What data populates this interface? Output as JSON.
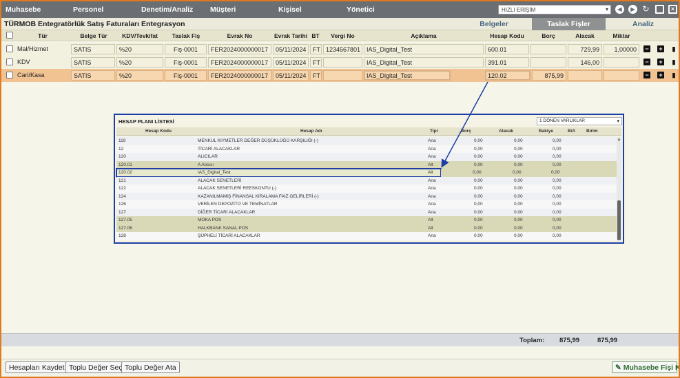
{
  "nav": {
    "items": [
      "Muhasebe",
      "Personel",
      "Denetim/Analiz",
      "Müşteri",
      "Kişisel",
      "Yönetici"
    ],
    "quick_access": "HIZLI ERİŞİM"
  },
  "title_bar": {
    "title": "TÜRMOB Entegratörlük Satış Faturaları Entegrasyon",
    "tabs": [
      "Belgeler",
      "Taslak Fişler",
      "Analiz"
    ],
    "active_tab": "Taslak Fişler"
  },
  "grid": {
    "headers": [
      "Tür",
      "Belge Tür",
      "KDV/Tevkifat",
      "Taslak Fiş",
      "Evrak No",
      "Evrak Tarihi",
      "BT",
      "Vergi No",
      "Açıklama",
      "Hesap Kodu",
      "Borç",
      "Alacak",
      "Miktar"
    ],
    "rows": [
      {
        "tur": "Mal/Hizmet",
        "belge_tur": "SATIS",
        "kdv": "%20",
        "taslak_fis": "Fiş-0001",
        "evrak_no": "FER2024000000017",
        "evrak_tarihi": "05/11/2024",
        "bt": "FT",
        "vergi_no": "1234567801",
        "aciklama": "IAS_Digital_Test",
        "hesap_kodu": "600.01",
        "borc": "",
        "alacak": "729,99",
        "miktar": "1,00000"
      },
      {
        "tur": "KDV",
        "belge_tur": "SATIS",
        "kdv": "%20",
        "taslak_fis": "Fiş-0001",
        "evrak_no": "FER2024000000017",
        "evrak_tarihi": "05/11/2024",
        "bt": "FT",
        "vergi_no": "",
        "aciklama": "IAS_Digital_Test",
        "hesap_kodu": "391.01",
        "borc": "",
        "alacak": "146,00",
        "miktar": ""
      },
      {
        "tur": "Cari/Kasa",
        "belge_tur": "SATIS",
        "kdv": "%20",
        "taslak_fis": "Fiş-0001",
        "evrak_no": "FER2024000000017",
        "evrak_tarihi": "05/11/2024",
        "bt": "FT",
        "vergi_no": "",
        "aciklama": "IAS_Digital_Test",
        "hesap_kodu": "120.02",
        "borc": "875,99",
        "alacak": "",
        "miktar": ""
      }
    ]
  },
  "popup": {
    "title": "HESAP PLANI LİSTESİ",
    "select_value": "1 DÖNEN VARLIKLAR",
    "headers": [
      "Hesap Kodu",
      "Hesap Adı",
      "Tipi",
      "Borç",
      "Alacak",
      "Bakiye",
      "B/A",
      "Birim"
    ],
    "rows": [
      {
        "kod": "119",
        "ad": "MENKUL KIYMETLER DEĞER DÜŞÜKLÜĞÜ KARŞILIĞI (-)",
        "tip": "Ana",
        "borc": "0,00",
        "alacak": "0,00",
        "bakiye": "0,00"
      },
      {
        "kod": "12",
        "ad": "TİCARİ ALACAKLAR",
        "tip": "Ana",
        "borc": "0,00",
        "alacak": "0,00",
        "bakiye": "0,00"
      },
      {
        "kod": "120",
        "ad": "ALICILAR",
        "tip": "Ana",
        "borc": "0,00",
        "alacak": "0,00",
        "bakiye": "0,00"
      },
      {
        "kod": "120.01",
        "ad": "A Alıcısı",
        "tip": "Alt",
        "borc": "0,00",
        "alacak": "0,00",
        "bakiye": "0,00"
      },
      {
        "kod": "120.02",
        "ad": "IAS_Digital_Test",
        "tip": "Alt",
        "borc": "0,00",
        "alacak": "0,00",
        "bakiye": "0,00"
      },
      {
        "kod": "121",
        "ad": "ALACAK SENETLERİ",
        "tip": "Ana",
        "borc": "0,00",
        "alacak": "0,00",
        "bakiye": "0,00"
      },
      {
        "kod": "122",
        "ad": "ALACAK SENETLERİ REESKONTU (-)",
        "tip": "Ana",
        "borc": "0,00",
        "alacak": "0,00",
        "bakiye": "0,00"
      },
      {
        "kod": "124",
        "ad": "KAZANILMAMIŞ FİNANSAL KİRALAMA FAİZ GELİRLERİ (-)",
        "tip": "Ana",
        "borc": "0,00",
        "alacak": "0,00",
        "bakiye": "0,00"
      },
      {
        "kod": "126",
        "ad": "VERİLEN DEPOZİTO VE TEMİNATLAR",
        "tip": "Ana",
        "borc": "0,00",
        "alacak": "0,00",
        "bakiye": "0,00"
      },
      {
        "kod": "127",
        "ad": "DİĞER TİCARİ ALACAKLAR",
        "tip": "Ana",
        "borc": "0,00",
        "alacak": "0,00",
        "bakiye": "0,00"
      },
      {
        "kod": "127.05",
        "ad": "MOKA POS",
        "tip": "Alt",
        "borc": "0,00",
        "alacak": "0,00",
        "bakiye": "0,00"
      },
      {
        "kod": "127.06",
        "ad": "HALKBANK SANAL POS",
        "tip": "Alt",
        "borc": "0,00",
        "alacak": "0,00",
        "bakiye": "0,00"
      },
      {
        "kod": "128",
        "ad": "ŞÜPHELİ TİCARİ ALACAKLAR",
        "tip": "Ana",
        "borc": "0,00",
        "alacak": "0,00",
        "bakiye": "0,00"
      }
    ]
  },
  "totals": {
    "label": "Toplam:",
    "borc": "875,99",
    "alacak": "875,99"
  },
  "buttons": {
    "save": "Hesapları Kaydet",
    "bulk_select": "Toplu Değer Seç",
    "bulk_assign": "Toplu Değer Ata",
    "create_slip": "Muhasebe Fişi Kes"
  },
  "colors": {
    "accent_border": "#e07a1c",
    "highlight": "#1d3fa5",
    "selected_row": "#f1c392",
    "nav_bg": "#6b6e72"
  }
}
